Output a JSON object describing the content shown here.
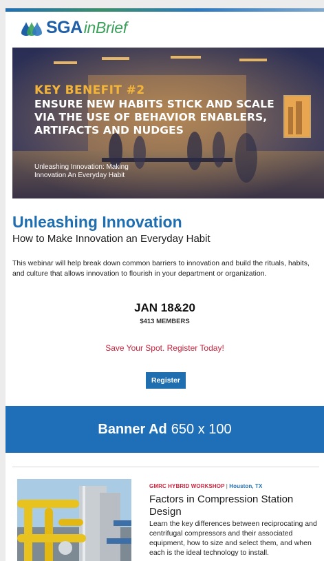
{
  "header": {
    "logo_primary": "SGA",
    "logo_secondary": "inBrief"
  },
  "hero": {
    "kicker": "KEY BENEFIT #2",
    "headline": "ENSURE NEW HABITS STICK AND SCALE VIA THE USE OF BEHAVIOR ENABLERS, ARTIFACTS AND NUDGES",
    "caption": "Unleashing Innovation: Making Innovation An Everyday Habit"
  },
  "event": {
    "title": "Unleashing Innovation",
    "subtitle": "How to Make Innovation an Everyday Habit",
    "description": "This webinar will help break down common barriers to innovation and build the rituals, habits, and culture that allows innovation to flourish in your department or organization.",
    "date": "JAN 18&20",
    "price": "$413 MEMBERS",
    "cta": "Save Your Spot. Register Today!",
    "register_label": "Register"
  },
  "banner": {
    "label_bold": "Banner Ad",
    "label_size": "650 x 100"
  },
  "workshop": {
    "category": "GMRC HYBRID WORKSHOP",
    "separator": "|",
    "location": "Houston, TX",
    "title": "Factors in Compression Station Design",
    "description": "Learn the key differences between reciprocating and centrifugal compressors and their associated equipment, how to size and select them, and when each is the ideal technology to install."
  },
  "colors": {
    "brand_blue": "#1f6eb0",
    "brand_green": "#3aa05a",
    "accent_red": "#c8243e",
    "banner_blue": "#1f6fb8",
    "hero_orange": "#f3b43a"
  }
}
